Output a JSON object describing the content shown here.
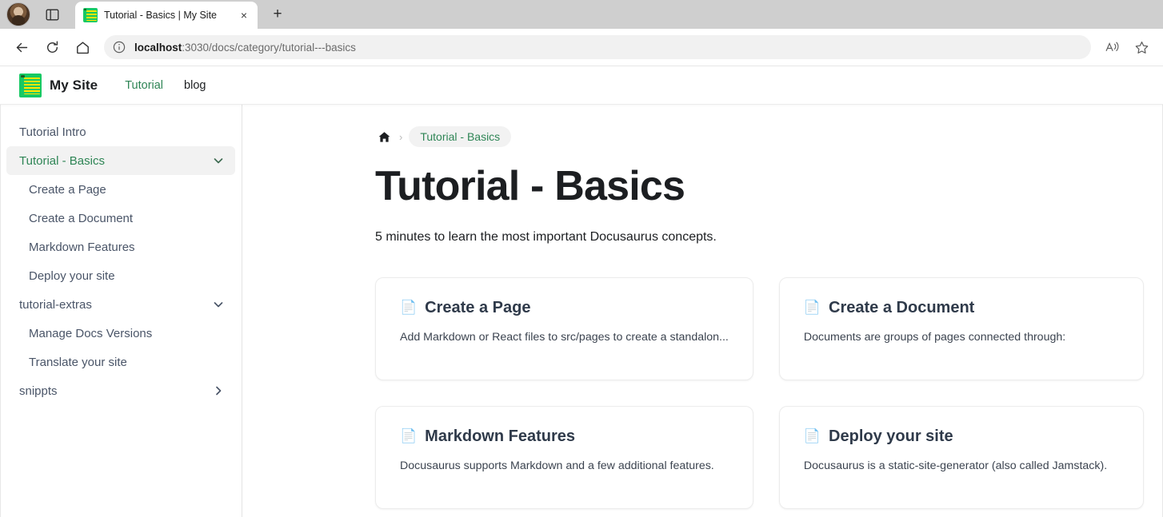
{
  "browser": {
    "tab": {
      "title": "Tutorial - Basics | My Site",
      "favicon": "docusaurus-notepad-icon",
      "close_label": "×"
    },
    "new_tab_label": "+",
    "toolbar": {
      "back_label": "back-arrow",
      "reload_label": "reload-arrow",
      "home_label": "home",
      "url_prefix": "localhost",
      "url_rest": ":3030/docs/category/tutorial---basics",
      "url_full": "localhost:3030/docs/category/tutorial---basics",
      "read_aloud_label": "read-aloud",
      "favorite_label": "add-to-favorites"
    }
  },
  "site": {
    "navbar": {
      "brand": "My Site",
      "links": [
        {
          "label": "Tutorial",
          "active": true
        },
        {
          "label": "blog",
          "active": false
        }
      ]
    },
    "sidebar": {
      "items": [
        {
          "label": "Tutorial Intro",
          "nested": false,
          "active": false,
          "chevron": "none"
        },
        {
          "label": "Tutorial - Basics",
          "nested": false,
          "active": true,
          "chevron": "down"
        },
        {
          "label": "Create a Page",
          "nested": true,
          "active": false,
          "chevron": "none"
        },
        {
          "label": "Create a Document",
          "nested": true,
          "active": false,
          "chevron": "none"
        },
        {
          "label": "Markdown Features",
          "nested": true,
          "active": false,
          "chevron": "none"
        },
        {
          "label": "Deploy your site",
          "nested": true,
          "active": false,
          "chevron": "none"
        },
        {
          "label": "tutorial-extras",
          "nested": false,
          "active": false,
          "chevron": "down"
        },
        {
          "label": "Manage Docs Versions",
          "nested": true,
          "active": false,
          "chevron": "none"
        },
        {
          "label": "Translate your site",
          "nested": true,
          "active": false,
          "chevron": "none"
        },
        {
          "label": "snippts",
          "nested": false,
          "active": false,
          "chevron": "right"
        }
      ]
    },
    "breadcrumbs": {
      "home_icon": "home-icon",
      "separator": "›",
      "current": "Tutorial - Basics"
    },
    "page": {
      "title": "Tutorial - Basics",
      "lede": "5 minutes to learn the most important Docusaurus concepts."
    },
    "cards": [
      {
        "icon": "📄",
        "title": "Create a Page",
        "desc": "Add Markdown or React files to src/pages to create a standalon..."
      },
      {
        "icon": "📄",
        "title": "Create a Document",
        "desc": "Documents are groups of pages connected through:"
      },
      {
        "icon": "📄",
        "title": "Markdown Features",
        "desc": "Docusaurus supports Markdown and a few additional features."
      },
      {
        "icon": "📄",
        "title": "Deploy your site",
        "desc": "Docusaurus is a static-site-generator (also called Jamstack)."
      }
    ]
  },
  "colors": {
    "accent_green": "#2e8555",
    "logo_green": "#17c964",
    "logo_yellow": "#ffe600",
    "heading": "#1c1e21",
    "sidebar_text": "#4a5568",
    "active_bg": "#f2f2f2",
    "chrome_tabstrip": "#cfcfcf",
    "omnibox_bg": "#f1f1f1"
  }
}
